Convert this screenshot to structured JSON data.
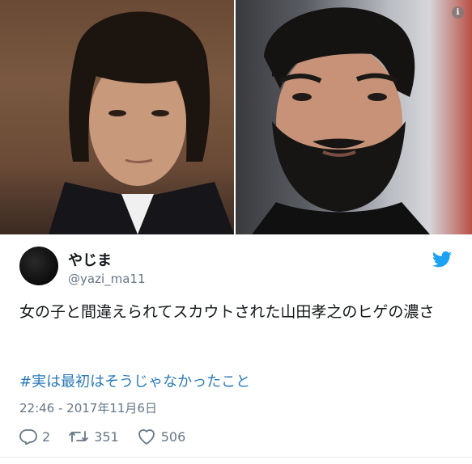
{
  "tweet": {
    "display_name": "やじま",
    "handle": "@yazi_ma11",
    "text": "女の子と間違えられてスカウトされた山田孝之のヒゲの濃さ",
    "hashtag": "#実は最初はそうじゃなかったこと",
    "timestamp": "22:46 - 2017年11月6日"
  },
  "media": {
    "info_icon_glyph": "i",
    "left_photo": "photo-young-face",
    "right_photo": "photo-bearded-face"
  },
  "actions": {
    "replies": "2",
    "retweets": "351",
    "likes": "506"
  },
  "icons": {
    "bird": "twitter-bird-icon",
    "reply": "reply-icon",
    "retweet": "retweet-icon",
    "like": "heart-icon",
    "info": "info-icon"
  },
  "colors": {
    "twitter_blue": "#1da1f2",
    "hashtag": "#2b7bb9",
    "secondary_text": "#657786",
    "primary_text": "#14171a"
  }
}
